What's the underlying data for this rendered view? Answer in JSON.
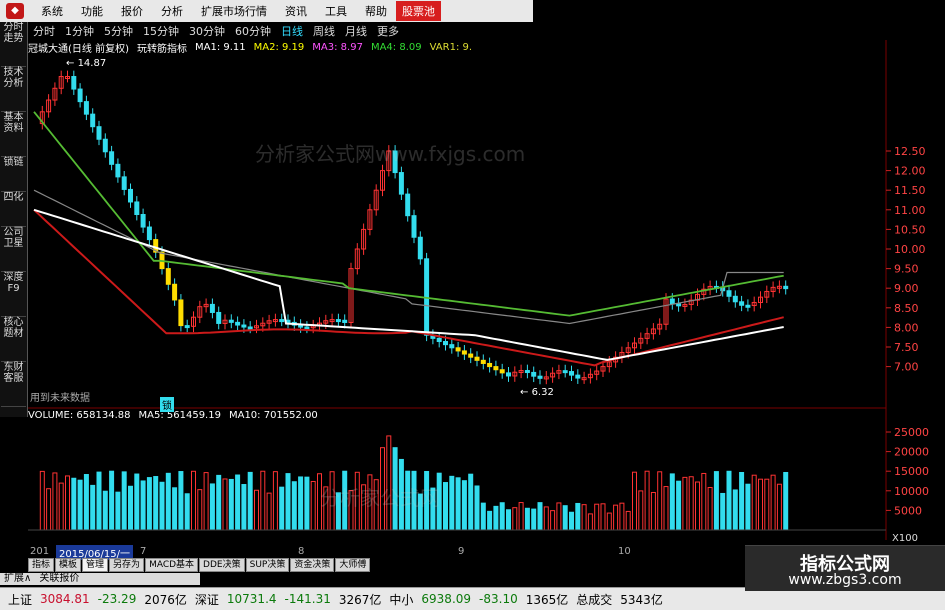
{
  "menu": {
    "items": [
      "系统",
      "功能",
      "报价",
      "分析",
      "扩展市场行情",
      "资讯",
      "工具",
      "帮助"
    ],
    "hot_item": "股票池"
  },
  "periods": {
    "items": [
      "分时",
      "1分钟",
      "5分钟",
      "15分钟",
      "30分钟",
      "60分钟",
      "日线",
      "周线",
      "月线",
      "更多"
    ],
    "active": "日线"
  },
  "left_tabs": [
    "分时走势",
    "技术分析",
    "基本资料",
    "锁链",
    "四化",
    "公司卫星",
    "深度F9",
    "核心题材",
    "东财客服"
  ],
  "indicator": {
    "stock_name": "冠城大通(日线 前复权)",
    "formula_name": "玩转筋指标",
    "ma1": "MA1: 9.11",
    "ma2": "MA2: 9.19",
    "ma3": "MA3: 8.97",
    "ma4": "MA4: 8.09",
    "var1": "VAR1: 9.",
    "color_ma1": "#ffffff",
    "color_ma2": "#ffff00",
    "color_ma3": "#ff55ff",
    "color_ma4": "#33dd33",
    "color_var1": "#dddd33"
  },
  "volume": {
    "label": "VOLUME: 658134.88",
    "ma5": "MA5: 561459.19",
    "ma10": "MA10: 701552.00"
  },
  "watermarks": {
    "main": "分析家公式网www.fxjgs.com",
    "volume": "分析家公式网"
  },
  "price_scale": {
    "ticks": [
      "12.50",
      "12.00",
      "11.50",
      "11.00",
      "10.50",
      "10.00",
      "9.50",
      "9.00",
      "8.50",
      "8.00",
      "7.50",
      "7.00"
    ],
    "tick_values": [
      12.5,
      12.0,
      11.5,
      11.0,
      10.5,
      10.0,
      9.5,
      9.0,
      8.5,
      8.0,
      7.5,
      7.0
    ]
  },
  "volume_scale": {
    "ticks": [
      "25000",
      "20000",
      "15000",
      "10000",
      "5000"
    ],
    "unit": "X100"
  },
  "annotations": {
    "high": "14.87",
    "low": "6.32",
    "future_note": "用到未来数据",
    "lock": "锁"
  },
  "date_axis": {
    "start_prefix": "201",
    "cursor_date": "2015/06/15/一",
    "months": [
      "7",
      "8",
      "9",
      "10"
    ]
  },
  "bottom_tabs": [
    "指标",
    "模板",
    "管理",
    "另存为",
    "MACD基本",
    "DDE决策",
    "SUP决策",
    "资金决策",
    "大师傅"
  ],
  "bottom_active": "管理",
  "left_strip": [
    "扩展∧",
    "关联报价"
  ],
  "status": {
    "sh_label": "上证",
    "sh_price": "3084.81",
    "sh_change": "-23.29",
    "sh_amount": "2076亿",
    "sz_label": "深证",
    "sz_price": "10731.4",
    "sz_change": "-141.31",
    "sz_amount": "3267亿",
    "zx_label": "中小",
    "zx_price": "6938.09",
    "zx_change": "-83.10",
    "zx_amount": "1365亿",
    "total_label": "总成交",
    "total_amount": "5343亿"
  },
  "brand": {
    "title": "指标公式网",
    "url": "www.zbgs3.com"
  },
  "colors": {
    "up": "#ff3333",
    "down": "#33ddee",
    "yellow_bar": "#ffdd00",
    "ma_white": "#ffffff",
    "ma_red": "#cc1a1a",
    "ma_green": "#55bb33",
    "grid": "#7a0000"
  }
}
